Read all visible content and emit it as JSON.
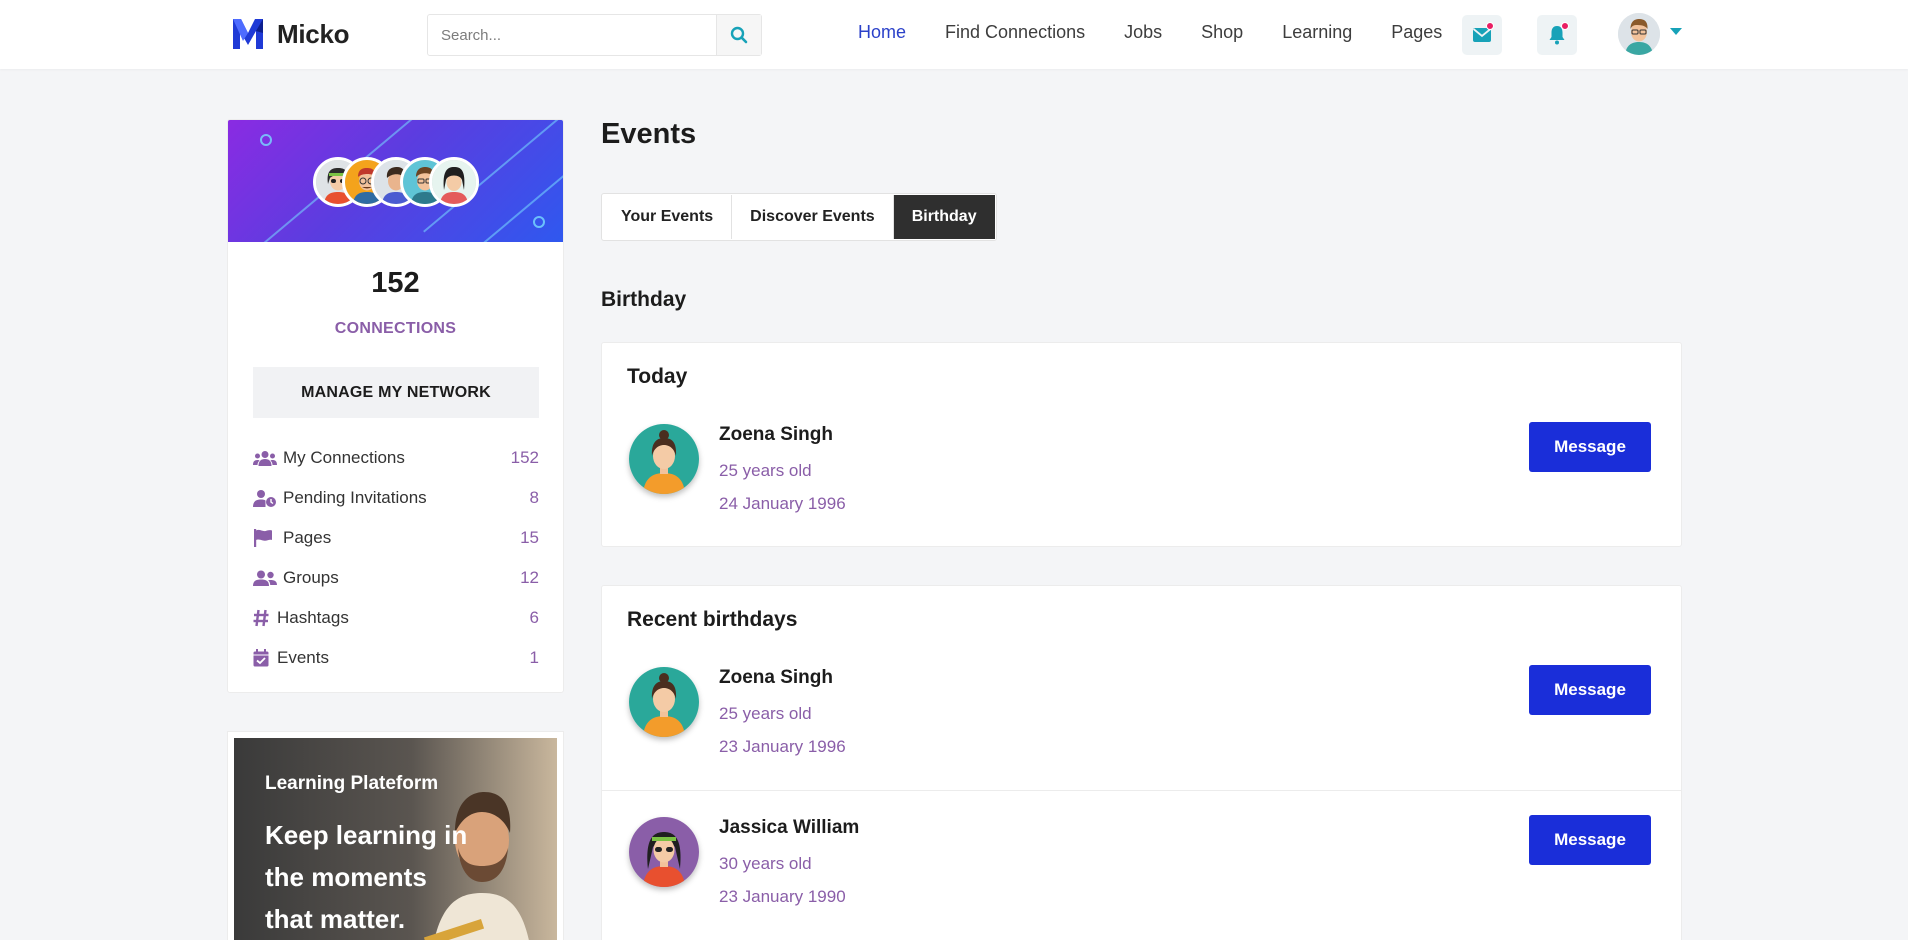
{
  "header": {
    "logo_text": "Micko",
    "search_placeholder": "Search...",
    "nav": [
      {
        "label": "Home"
      },
      {
        "label": "Find Connections"
      },
      {
        "label": "Jobs"
      },
      {
        "label": "Shop"
      },
      {
        "label": "Learning"
      },
      {
        "label": "Pages"
      }
    ],
    "active_nav": "Home",
    "accent_color": "#2b41c9",
    "icon_color": "#17a2b8",
    "badge_color": "#e91e63"
  },
  "sidebar": {
    "connections_count": "152",
    "connections_label": "CONNECTIONS",
    "manage_label": "MANAGE MY NETWORK",
    "items": [
      {
        "label": "My Connections",
        "count": "152",
        "icon": "users-icon"
      },
      {
        "label": "Pending Invitations",
        "count": "8",
        "icon": "user-clock-icon"
      },
      {
        "label": "Pages",
        "count": "15",
        "icon": "flag-icon"
      },
      {
        "label": "Groups",
        "count": "12",
        "icon": "user-group-icon"
      },
      {
        "label": "Hashtags",
        "count": "6",
        "icon": "hashtag-icon"
      },
      {
        "label": "Events",
        "count": "1",
        "icon": "calendar-check-icon"
      }
    ],
    "ad": {
      "subtitle": "Learning Plateform",
      "title": "Keep learning in the moments that matter."
    }
  },
  "main": {
    "page_title": "Events",
    "tabs": [
      {
        "label": "Your Events"
      },
      {
        "label": "Discover Events"
      },
      {
        "label": "Birthday"
      }
    ],
    "active_tab": "Birthday",
    "section_title": "Birthday",
    "today": {
      "title": "Today",
      "people": [
        {
          "name": "Zoena Singh",
          "age": "25 years old",
          "date": "24 January 1996",
          "button": "Message"
        }
      ]
    },
    "recent": {
      "title": "Recent birthdays",
      "people": [
        {
          "name": "Zoena Singh",
          "age": "25 years old",
          "date": "23 January 1996",
          "button": "Message"
        },
        {
          "name": "Jassica William",
          "age": "30 years old",
          "date": "23 January 1990",
          "button": "Message"
        }
      ]
    },
    "button_color": "#1a2ed9",
    "meta_color": "#8a5ea8"
  }
}
